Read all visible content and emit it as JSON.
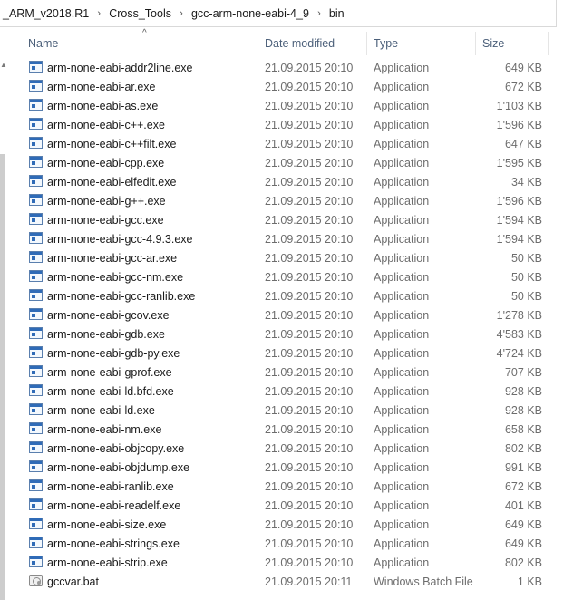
{
  "breadcrumb": [
    "_ARM_v2018.R1",
    "Cross_Tools",
    "gcc-arm-none-eabi-4_9",
    "bin"
  ],
  "breadcrumb_separator": "›",
  "columns": {
    "name": "Name",
    "date": "Date modified",
    "type": "Type",
    "size": "Size"
  },
  "sort_indicator": "^",
  "files": [
    {
      "name": "arm-none-eabi-addr2line.exe",
      "date": "21.09.2015 20:10",
      "type": "Application",
      "size": "649 KB",
      "icon": "exe"
    },
    {
      "name": "arm-none-eabi-ar.exe",
      "date": "21.09.2015 20:10",
      "type": "Application",
      "size": "672 KB",
      "icon": "exe"
    },
    {
      "name": "arm-none-eabi-as.exe",
      "date": "21.09.2015 20:10",
      "type": "Application",
      "size": "1'103 KB",
      "icon": "exe"
    },
    {
      "name": "arm-none-eabi-c++.exe",
      "date": "21.09.2015 20:10",
      "type": "Application",
      "size": "1'596 KB",
      "icon": "exe"
    },
    {
      "name": "arm-none-eabi-c++filt.exe",
      "date": "21.09.2015 20:10",
      "type": "Application",
      "size": "647 KB",
      "icon": "exe"
    },
    {
      "name": "arm-none-eabi-cpp.exe",
      "date": "21.09.2015 20:10",
      "type": "Application",
      "size": "1'595 KB",
      "icon": "exe"
    },
    {
      "name": "arm-none-eabi-elfedit.exe",
      "date": "21.09.2015 20:10",
      "type": "Application",
      "size": "34 KB",
      "icon": "exe"
    },
    {
      "name": "arm-none-eabi-g++.exe",
      "date": "21.09.2015 20:10",
      "type": "Application",
      "size": "1'596 KB",
      "icon": "exe"
    },
    {
      "name": "arm-none-eabi-gcc.exe",
      "date": "21.09.2015 20:10",
      "type": "Application",
      "size": "1'594 KB",
      "icon": "exe"
    },
    {
      "name": "arm-none-eabi-gcc-4.9.3.exe",
      "date": "21.09.2015 20:10",
      "type": "Application",
      "size": "1'594 KB",
      "icon": "exe"
    },
    {
      "name": "arm-none-eabi-gcc-ar.exe",
      "date": "21.09.2015 20:10",
      "type": "Application",
      "size": "50 KB",
      "icon": "exe"
    },
    {
      "name": "arm-none-eabi-gcc-nm.exe",
      "date": "21.09.2015 20:10",
      "type": "Application",
      "size": "50 KB",
      "icon": "exe"
    },
    {
      "name": "arm-none-eabi-gcc-ranlib.exe",
      "date": "21.09.2015 20:10",
      "type": "Application",
      "size": "50 KB",
      "icon": "exe"
    },
    {
      "name": "arm-none-eabi-gcov.exe",
      "date": "21.09.2015 20:10",
      "type": "Application",
      "size": "1'278 KB",
      "icon": "exe"
    },
    {
      "name": "arm-none-eabi-gdb.exe",
      "date": "21.09.2015 20:10",
      "type": "Application",
      "size": "4'583 KB",
      "icon": "exe"
    },
    {
      "name": "arm-none-eabi-gdb-py.exe",
      "date": "21.09.2015 20:10",
      "type": "Application",
      "size": "4'724 KB",
      "icon": "exe"
    },
    {
      "name": "arm-none-eabi-gprof.exe",
      "date": "21.09.2015 20:10",
      "type": "Application",
      "size": "707 KB",
      "icon": "exe"
    },
    {
      "name": "arm-none-eabi-ld.bfd.exe",
      "date": "21.09.2015 20:10",
      "type": "Application",
      "size": "928 KB",
      "icon": "exe"
    },
    {
      "name": "arm-none-eabi-ld.exe",
      "date": "21.09.2015 20:10",
      "type": "Application",
      "size": "928 KB",
      "icon": "exe"
    },
    {
      "name": "arm-none-eabi-nm.exe",
      "date": "21.09.2015 20:10",
      "type": "Application",
      "size": "658 KB",
      "icon": "exe"
    },
    {
      "name": "arm-none-eabi-objcopy.exe",
      "date": "21.09.2015 20:10",
      "type": "Application",
      "size": "802 KB",
      "icon": "exe"
    },
    {
      "name": "arm-none-eabi-objdump.exe",
      "date": "21.09.2015 20:10",
      "type": "Application",
      "size": "991 KB",
      "icon": "exe"
    },
    {
      "name": "arm-none-eabi-ranlib.exe",
      "date": "21.09.2015 20:10",
      "type": "Application",
      "size": "672 KB",
      "icon": "exe"
    },
    {
      "name": "arm-none-eabi-readelf.exe",
      "date": "21.09.2015 20:10",
      "type": "Application",
      "size": "401 KB",
      "icon": "exe"
    },
    {
      "name": "arm-none-eabi-size.exe",
      "date": "21.09.2015 20:10",
      "type": "Application",
      "size": "649 KB",
      "icon": "exe"
    },
    {
      "name": "arm-none-eabi-strings.exe",
      "date": "21.09.2015 20:10",
      "type": "Application",
      "size": "649 KB",
      "icon": "exe"
    },
    {
      "name": "arm-none-eabi-strip.exe",
      "date": "21.09.2015 20:10",
      "type": "Application",
      "size": "802 KB",
      "icon": "exe"
    },
    {
      "name": "gccvar.bat",
      "date": "21.09.2015 20:11",
      "type": "Windows Batch File",
      "size": "1 KB",
      "icon": "bat"
    }
  ]
}
